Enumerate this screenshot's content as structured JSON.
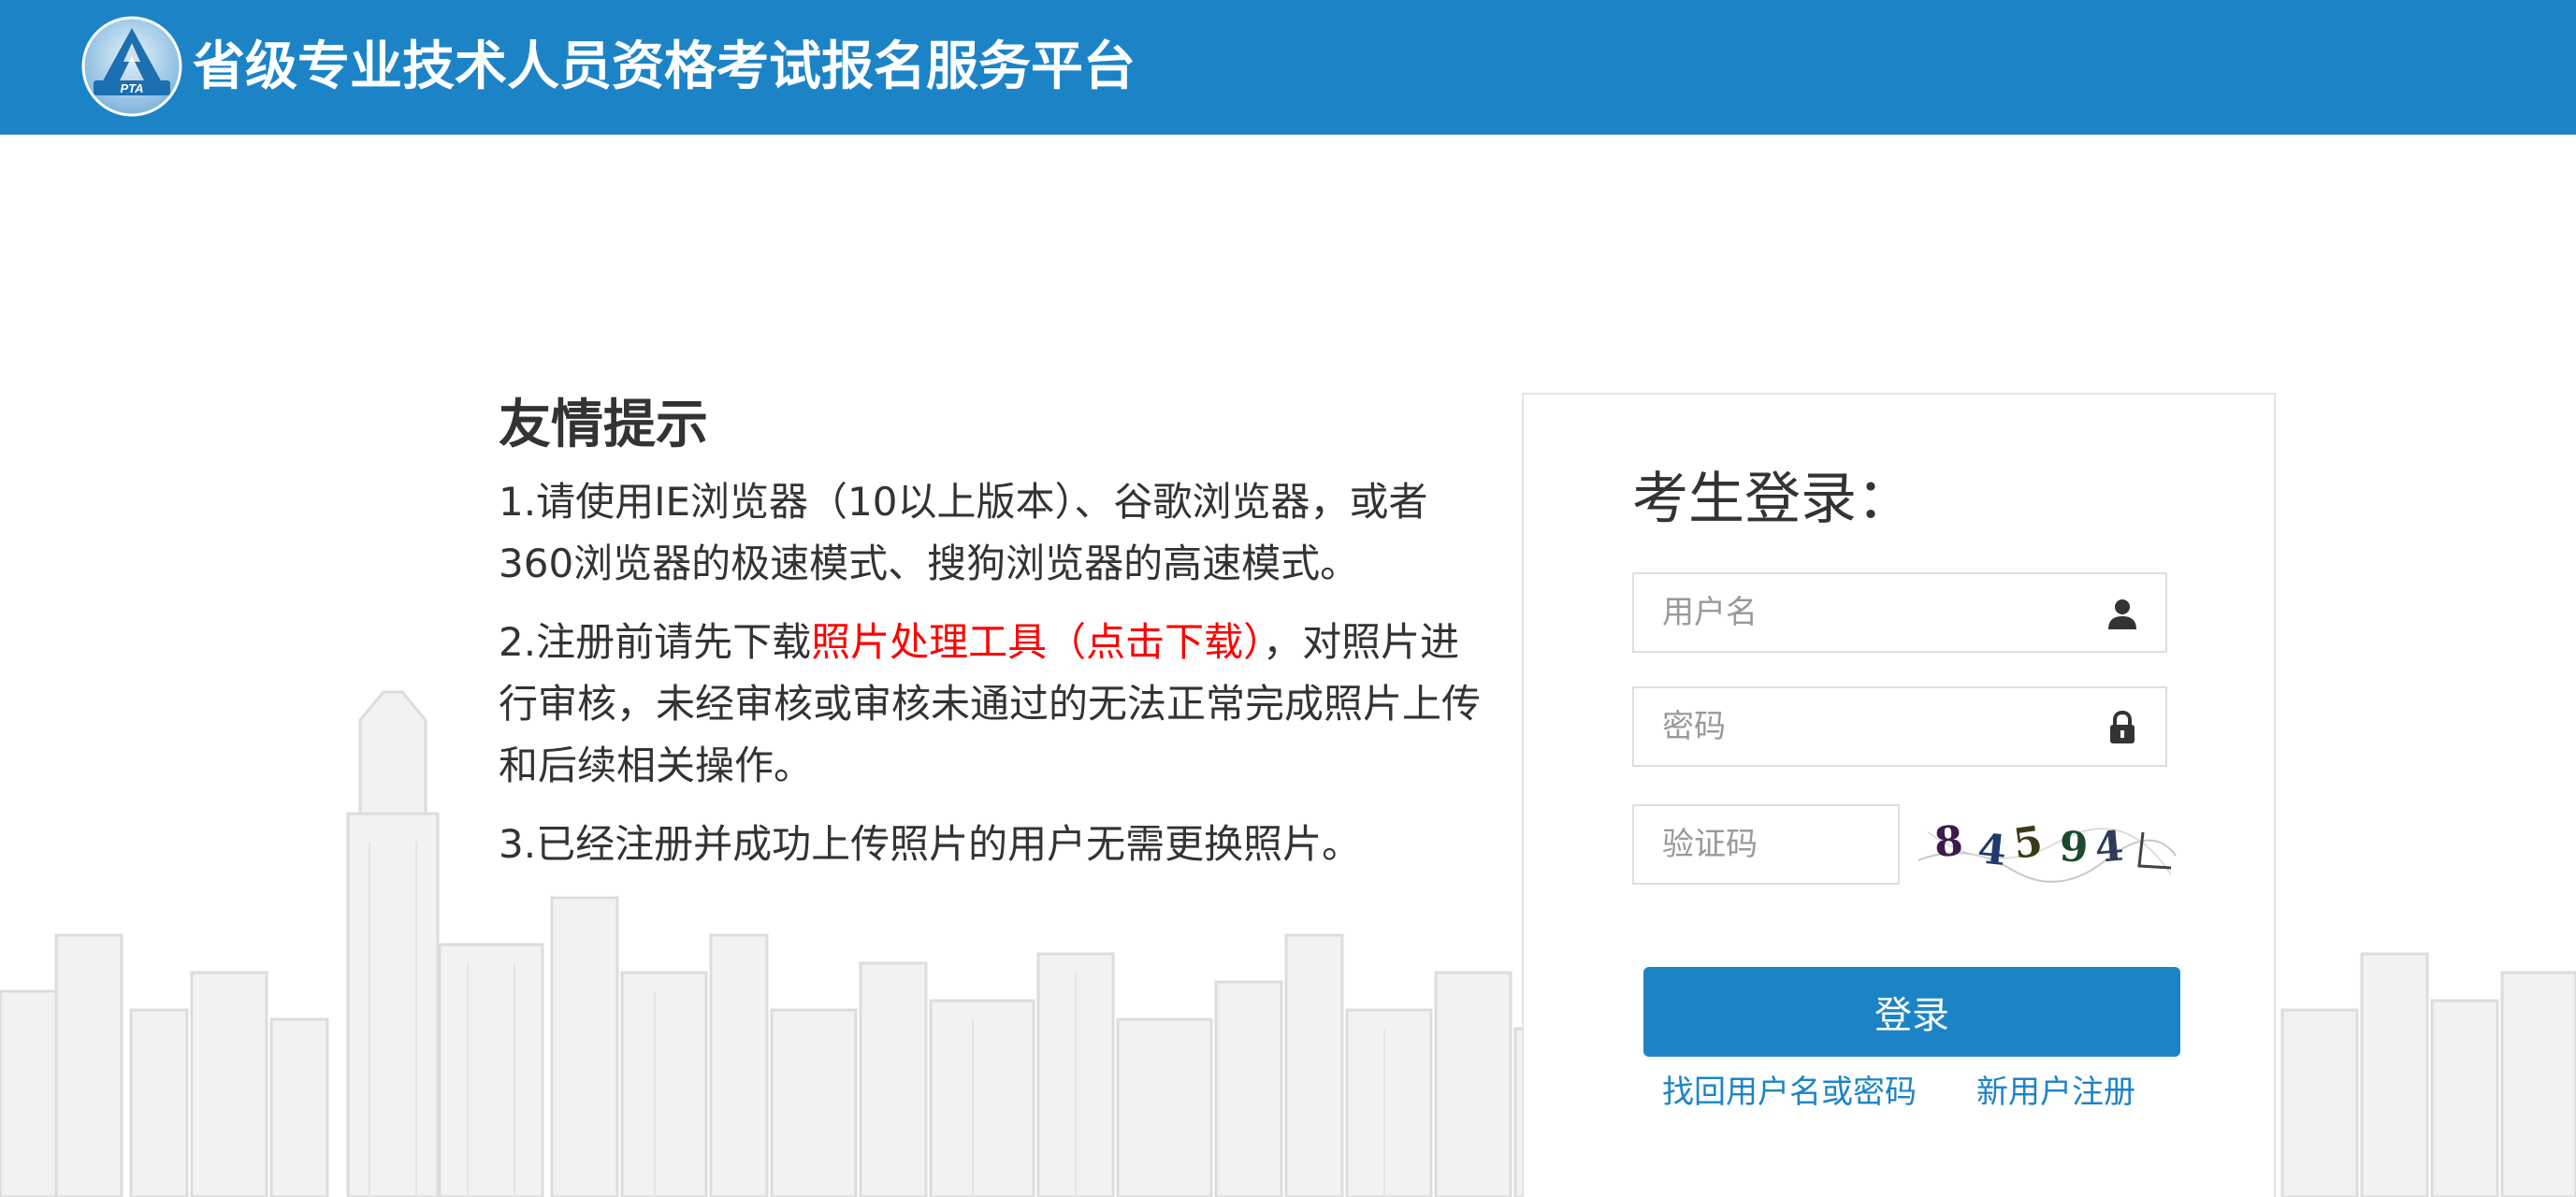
{
  "header": {
    "logo_text": "PTA",
    "title": "省级专业技术人员资格考试报名服务平台"
  },
  "tips": {
    "title": "友情提示",
    "item1": "1.请使用IE浏览器（10以上版本）、谷歌浏览器，或者360浏览器的极速模式、搜狗浏览器的高速模式。",
    "item2_before": "2.注册前请先下载",
    "item2_link": "照片处理工具（点击下载）",
    "item2_after": "，对照片进行审核，未经审核或审核未通过的无法正常完成照片上传和后续相关操作。",
    "item3": "3.已经注册并成功上传照片的用户无需更换照片。"
  },
  "login": {
    "title": "考生登录：",
    "username_placeholder": "用户名",
    "username_icon": "user-icon",
    "password_placeholder": "密码",
    "password_icon": "lock-icon",
    "captcha_placeholder": "验证码",
    "captcha_code": "84594",
    "submit_label": "登录",
    "forgot_label": "找回用户名或密码",
    "register_label": "新用户注册"
  },
  "colors": {
    "brand": "#1c84c6",
    "link_red": "#ff0000",
    "text": "#333333",
    "placeholder": "#999999"
  }
}
